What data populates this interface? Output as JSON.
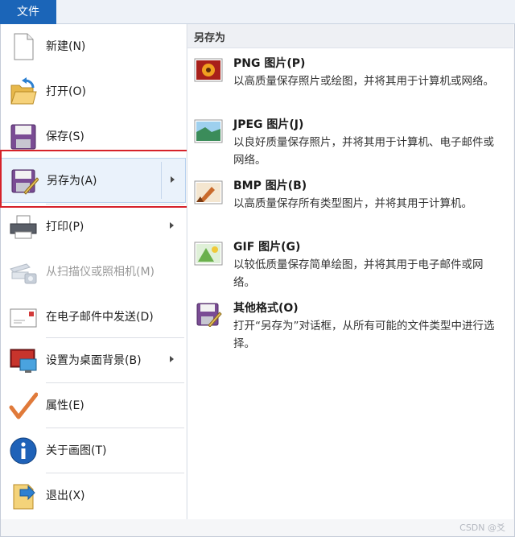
{
  "menubar": {
    "file_tab": "文件"
  },
  "left_menu": {
    "items": [
      {
        "label": "新建(N)",
        "icon": "new-document-icon"
      },
      {
        "label": "打开(O)",
        "icon": "open-folder-icon"
      },
      {
        "label": "保存(S)",
        "icon": "save-icon"
      },
      {
        "label": "另存为(A)",
        "icon": "save-as-icon",
        "submenu": true,
        "selected": true
      },
      {
        "label": "打印(P)",
        "icon": "printer-icon",
        "submenu": true
      },
      {
        "label": "从扫描仪或照相机(M)",
        "icon": "scanner-camera-icon",
        "disabled": true
      },
      {
        "label": "在电子邮件中发送(D)",
        "icon": "email-icon"
      },
      {
        "label": "设置为桌面背景(B)",
        "icon": "desktop-background-icon",
        "submenu": true
      },
      {
        "label": "属性(E)",
        "icon": "properties-check-icon"
      },
      {
        "label": "关于画图(T)",
        "icon": "info-icon"
      },
      {
        "label": "退出(X)",
        "icon": "exit-icon"
      }
    ]
  },
  "save_as_panel": {
    "heading": "另存为",
    "formats": [
      {
        "title": "PNG 图片(P)",
        "desc": "以高质量保存照片或绘图，并将其用于计算机或网络。",
        "icon": "png-image-icon"
      },
      {
        "title": "JPEG 图片(J)",
        "desc": "以良好质量保存照片，并将其用于计算机、电子邮件或网络。",
        "icon": "jpeg-image-icon"
      },
      {
        "title": "BMP 图片(B)",
        "desc": "以高质量保存所有类型图片，并将其用于计算机。",
        "icon": "bmp-image-icon"
      },
      {
        "title": "GIF 图片(G)",
        "desc": "以较低质量保存简单绘图，并将其用于电子邮件或网络。",
        "icon": "gif-image-icon"
      },
      {
        "title": "其他格式(O)",
        "desc": "打开“另存为”对话框，从所有可能的文件类型中进行选择。",
        "icon": "other-formats-icon"
      }
    ]
  },
  "watermark": "CSDN @爻",
  "colors": {
    "accent": "#1b65b8",
    "highlight_border": "#d6222a",
    "hover_bg": "#eaf2fb"
  }
}
